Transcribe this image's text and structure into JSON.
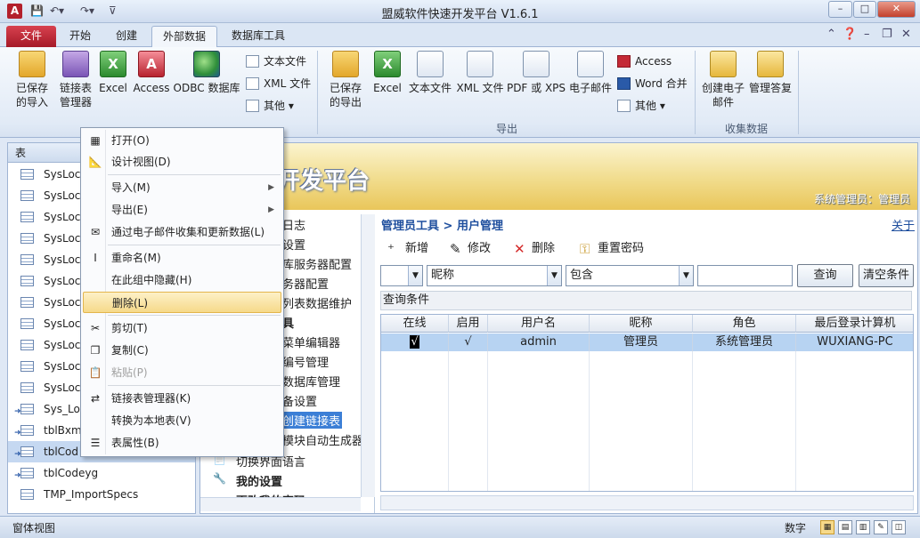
{
  "window": {
    "title": "盟威软件快速开发平台 V1.6.1",
    "app_icon_letter": "A"
  },
  "tabs": [
    "文件",
    "开始",
    "创建",
    "外部数据",
    "数据库工具"
  ],
  "ribbon": {
    "import_buttons": [
      "已保存的导入",
      "链接表管理器",
      "Excel",
      "Access",
      "ODBC 数据库"
    ],
    "import_small": [
      "文本文件",
      "XML 文件",
      "其他"
    ],
    "export_buttons": [
      "已保存的导出",
      "Excel",
      "文本文件",
      "XML 文件",
      "PDF 或 XPS",
      "电子邮件"
    ],
    "export_small": [
      "Access",
      "Word 合并",
      "其他"
    ],
    "export_group": "导出",
    "collect_buttons": [
      "创建电子邮件",
      "管理答复"
    ],
    "collect_group": "收集数据"
  },
  "nav": {
    "header": "表",
    "items": [
      "SysLoc",
      "SysLoc",
      "SysLoc",
      "SysLoc",
      "SysLoc",
      "SysLoc",
      "SysLoc",
      "SysLoc",
      "SysLoc",
      "SysLoc",
      "SysLoc",
      "Sys_Loc",
      "tblBxm",
      "tblCod",
      "tblCodeyg",
      "TMP_ImportSpecs"
    ]
  },
  "context_menu": [
    {
      "label": "打开(O)",
      "icon": "open-icon"
    },
    {
      "label": "设计视图(D)",
      "icon": "design-icon"
    },
    {
      "label": "导入(M)",
      "submenu": true
    },
    {
      "label": "导出(E)",
      "submenu": true
    },
    {
      "label": "通过电子邮件收集和更新数据(L)",
      "icon": "collect-icon"
    },
    {
      "label": "重命名(M)",
      "icon": "rename-icon"
    },
    {
      "label": "在此组中隐藏(H)"
    },
    {
      "label": "删除(L)",
      "highlighted": true
    },
    {
      "label": "剪切(T)",
      "icon": "cut-icon"
    },
    {
      "label": "复制(C)",
      "icon": "copy-icon"
    },
    {
      "label": "粘贴(P)",
      "icon": "paste-icon",
      "disabled": true
    },
    {
      "label": "链接表管理器(K)",
      "icon": "linked-table-icon"
    },
    {
      "label": "转换为本地表(V)"
    },
    {
      "label": "表属性(B)",
      "icon": "properties-icon"
    }
  ],
  "banner": {
    "title": "件快速开发平台",
    "user": "系统管理员：管理员"
  },
  "menu_tree": [
    "日志",
    "设置",
    "库服务器配置",
    "务器配置",
    "列表数据维护",
    "具",
    "菜单编辑器",
    "编号管理",
    "数据库管理",
    "备设置",
    "创建链接表",
    "模块自动生成器",
    "切换界面语言",
    "我的设置",
    "更改我的密码"
  ],
  "content": {
    "breadcrumb": "管理员工具 > 用户管理",
    "about": "关于",
    "toolbar": [
      "新增",
      "修改",
      "删除",
      "重置密码"
    ],
    "field_select": "昵称",
    "operator_select": "包含",
    "query_button": "查询",
    "clear_button": "清空条件",
    "condition_label": "查询条件",
    "grid": {
      "columns": [
        "在线",
        "启用",
        "用户名",
        "昵称",
        "角色",
        "最后登录计算机"
      ],
      "rows": [
        [
          "√",
          "√",
          "admin",
          "管理员",
          "系统管理员",
          "WUXIANG-PC"
        ]
      ]
    }
  },
  "status": {
    "left": "窗体视图",
    "right": "数字"
  }
}
